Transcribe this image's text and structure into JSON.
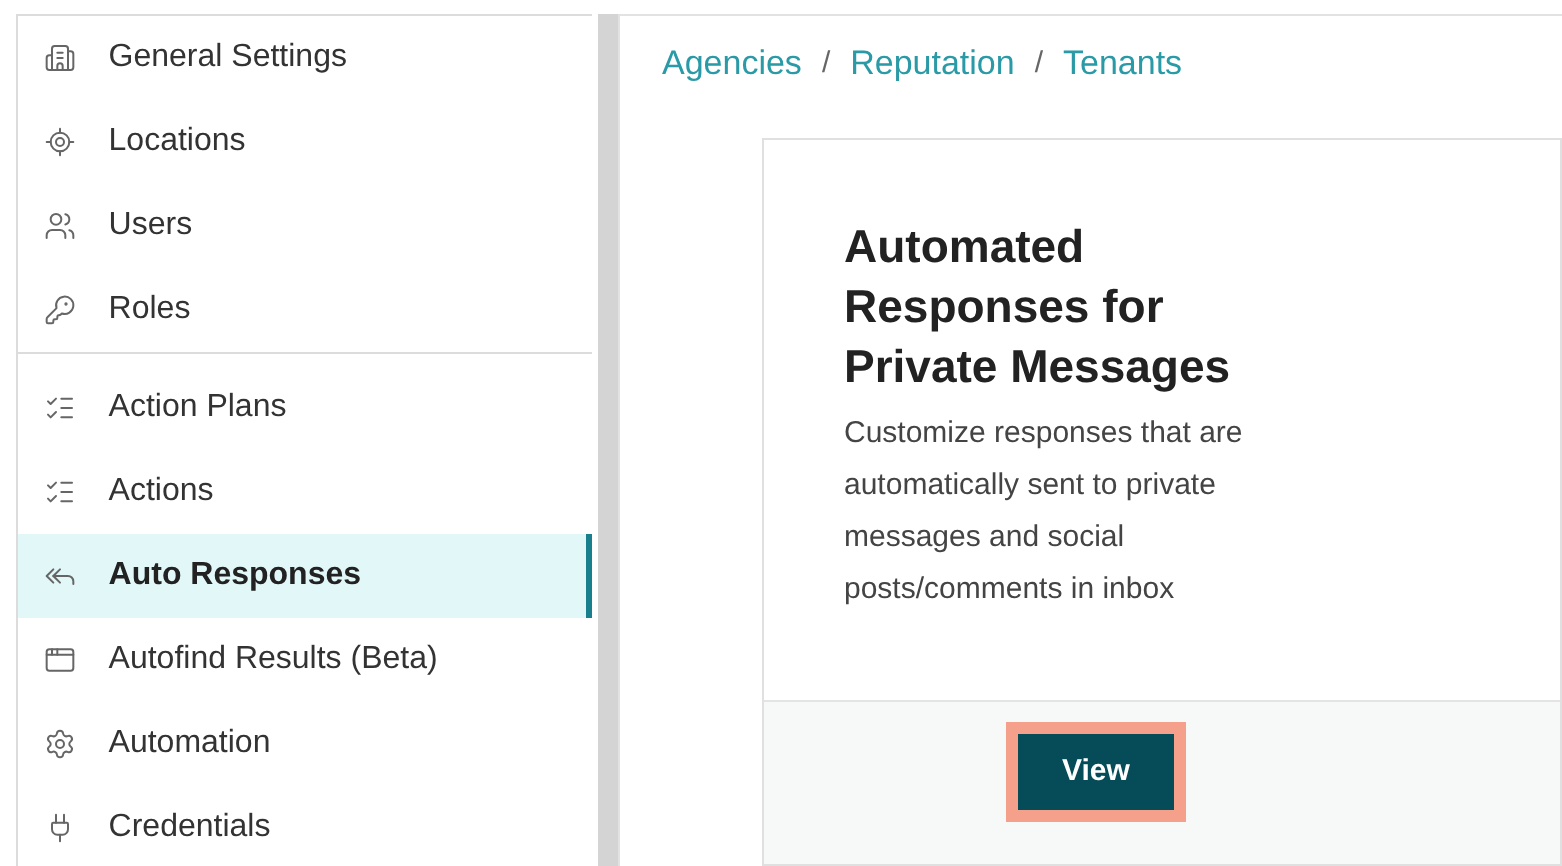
{
  "sidebar": {
    "groups": [
      {
        "items": [
          {
            "label": "General Settings",
            "selected": false
          },
          {
            "label": "Locations",
            "selected": false
          },
          {
            "label": "Users",
            "selected": false
          },
          {
            "label": "Roles",
            "selected": false
          }
        ]
      },
      {
        "items": [
          {
            "label": "Action Plans",
            "selected": false
          },
          {
            "label": "Actions",
            "selected": false
          },
          {
            "label": "Auto Responses",
            "selected": true
          },
          {
            "label": "Autofind Results (Beta)",
            "selected": false
          },
          {
            "label": "Automation",
            "selected": false
          },
          {
            "label": "Credentials",
            "selected": false
          }
        ]
      }
    ]
  },
  "breadcrumb": [
    {
      "kind": "link",
      "text": "Agencies"
    },
    {
      "kind": "separator",
      "text": "/"
    },
    {
      "kind": "link",
      "text": "Reputation"
    },
    {
      "kind": "separator",
      "text": "/"
    },
    {
      "kind": "link",
      "text": "Tenants"
    }
  ],
  "card": {
    "title": "Automated Responses for Private Messages",
    "description": "Customize responses that are automatically sent to private messages and social posts/comments in inbox",
    "button": {
      "label": "View",
      "highlighted": true
    }
  }
}
